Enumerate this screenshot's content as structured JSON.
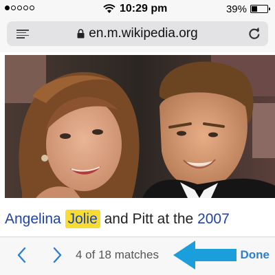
{
  "status_bar": {
    "signal_dots_filled": 1,
    "signal_dots_total": 5,
    "time": "10:29 pm",
    "battery_percent": "39%",
    "battery_level": 0.39,
    "icons": [
      "wifi-icon",
      "battery-icon"
    ]
  },
  "toolbar": {
    "url": "en.m.wikipedia.org",
    "icons": [
      "reader-icon",
      "lock-icon",
      "reload-icon"
    ]
  },
  "photo": {
    "icons": [
      "photo"
    ]
  },
  "caption": {
    "text_before": "Angelina",
    "highlighted_match": "Jolie",
    "text_middle": "and Pitt at the",
    "text_link_end": "2007"
  },
  "find_bar": {
    "match_count": "4 of 18 matches",
    "done_label": "Done",
    "icons": [
      "chevron-left-icon",
      "chevron-right-icon",
      "annotation-arrow-icon"
    ]
  },
  "colors": {
    "link": "#1f43a8",
    "highlight": "#f7dc34",
    "accent": "#2b7fd3",
    "annotation_arrow": "#1b9fdc"
  }
}
